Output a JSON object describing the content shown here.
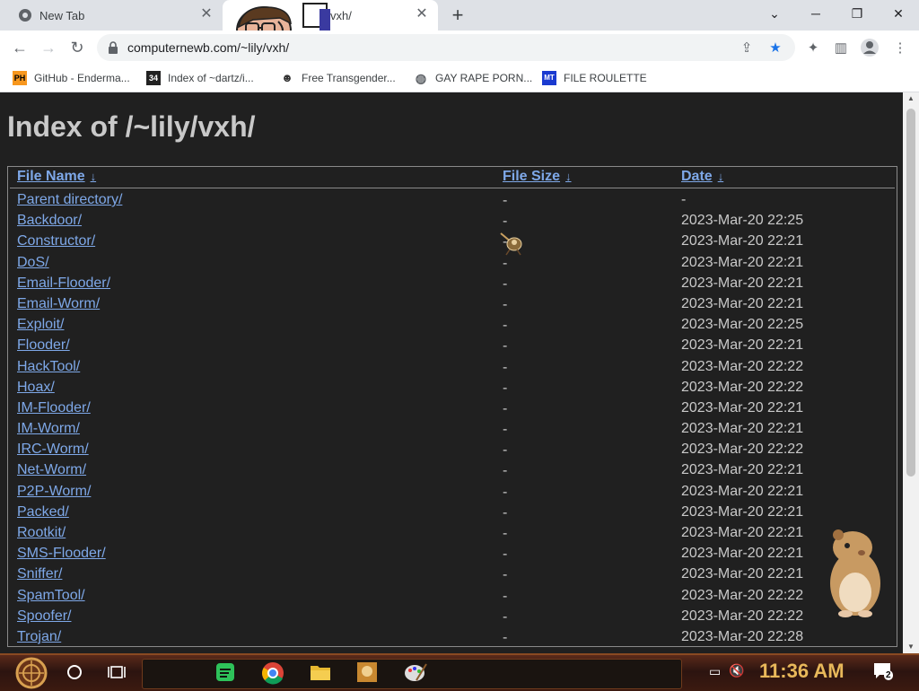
{
  "browser": {
    "tabs": [
      {
        "title": "New Tab",
        "active": false
      },
      {
        "title": "vxh/",
        "active": true
      }
    ],
    "new_tab_symbol": "+",
    "address": "computernewb.com/~lily/vxh/",
    "address_visible": "computernewb.co     ily/vxh/",
    "window_controls": {
      "dropdown": "⌄",
      "minimize": "─",
      "restore": "❐",
      "close": "✕"
    }
  },
  "bookmarks": [
    {
      "label": "GitHub - Enderma...",
      "icon": "PH"
    },
    {
      "label": "Index of ~dartz/i...",
      "icon": "34"
    },
    {
      "label": "Free Transgender...",
      "icon": "mask-icon"
    },
    {
      "label": "GAY RAPE PORN...",
      "icon": "globe-icon"
    },
    {
      "label": "FILE ROULETTE",
      "icon": "MT"
    }
  ],
  "page": {
    "title": "Index of /~lily/vxh/",
    "columns": {
      "name": "File Name",
      "size": "File Size",
      "date": "Date",
      "sort_glyph": "↓"
    },
    "rows": [
      {
        "name": "Parent directory/",
        "size": "-",
        "date": "-"
      },
      {
        "name": "Backdoor/",
        "size": "-",
        "date": "2023-Mar-20 22:25"
      },
      {
        "name": "Constructor/",
        "size": "-",
        "date": "2023-Mar-20 22:21"
      },
      {
        "name": "DoS/",
        "size": "-",
        "date": "2023-Mar-20 22:21"
      },
      {
        "name": "Email-Flooder/",
        "size": "-",
        "date": "2023-Mar-20 22:21"
      },
      {
        "name": "Email-Worm/",
        "size": "-",
        "date": "2023-Mar-20 22:21"
      },
      {
        "name": "Exploit/",
        "size": "-",
        "date": "2023-Mar-20 22:25"
      },
      {
        "name": "Flooder/",
        "size": "-",
        "date": "2023-Mar-20 22:21"
      },
      {
        "name": "HackTool/",
        "size": "-",
        "date": "2023-Mar-20 22:22"
      },
      {
        "name": "Hoax/",
        "size": "-",
        "date": "2023-Mar-20 22:22"
      },
      {
        "name": "IM-Flooder/",
        "size": "-",
        "date": "2023-Mar-20 22:21"
      },
      {
        "name": "IM-Worm/",
        "size": "-",
        "date": "2023-Mar-20 22:21"
      },
      {
        "name": "IRC-Worm/",
        "size": "-",
        "date": "2023-Mar-20 22:22"
      },
      {
        "name": "Net-Worm/",
        "size": "-",
        "date": "2023-Mar-20 22:21"
      },
      {
        "name": "P2P-Worm/",
        "size": "-",
        "date": "2023-Mar-20 22:21"
      },
      {
        "name": "Packed/",
        "size": "-",
        "date": "2023-Mar-20 22:21"
      },
      {
        "name": "Rootkit/",
        "size": "-",
        "date": "2023-Mar-20 22:21"
      },
      {
        "name": "SMS-Flooder/",
        "size": "-",
        "date": "2023-Mar-20 22:21"
      },
      {
        "name": "Sniffer/",
        "size": "-",
        "date": "2023-Mar-20 22:21"
      },
      {
        "name": "SpamTool/",
        "size": "-",
        "date": "2023-Mar-20 22:22"
      },
      {
        "name": "Spoofer/",
        "size": "-",
        "date": "2023-Mar-20 22:22"
      },
      {
        "name": "Trojan/",
        "size": "-",
        "date": "2023-Mar-20 22:28"
      }
    ]
  },
  "taskbar": {
    "clock": "11:36 AM",
    "notification_count": "2",
    "apps": [
      "start-orb",
      "search-icon",
      "task-view-icon",
      "spotify-icon",
      "chrome-icon",
      "file-explorer-icon",
      "app-icon",
      "paint-icon"
    ]
  },
  "colors": {
    "page_bg": "#202020",
    "text": "#c9c9c9",
    "link": "#7ea8e8",
    "bookmark_star": "#1a73e8"
  }
}
